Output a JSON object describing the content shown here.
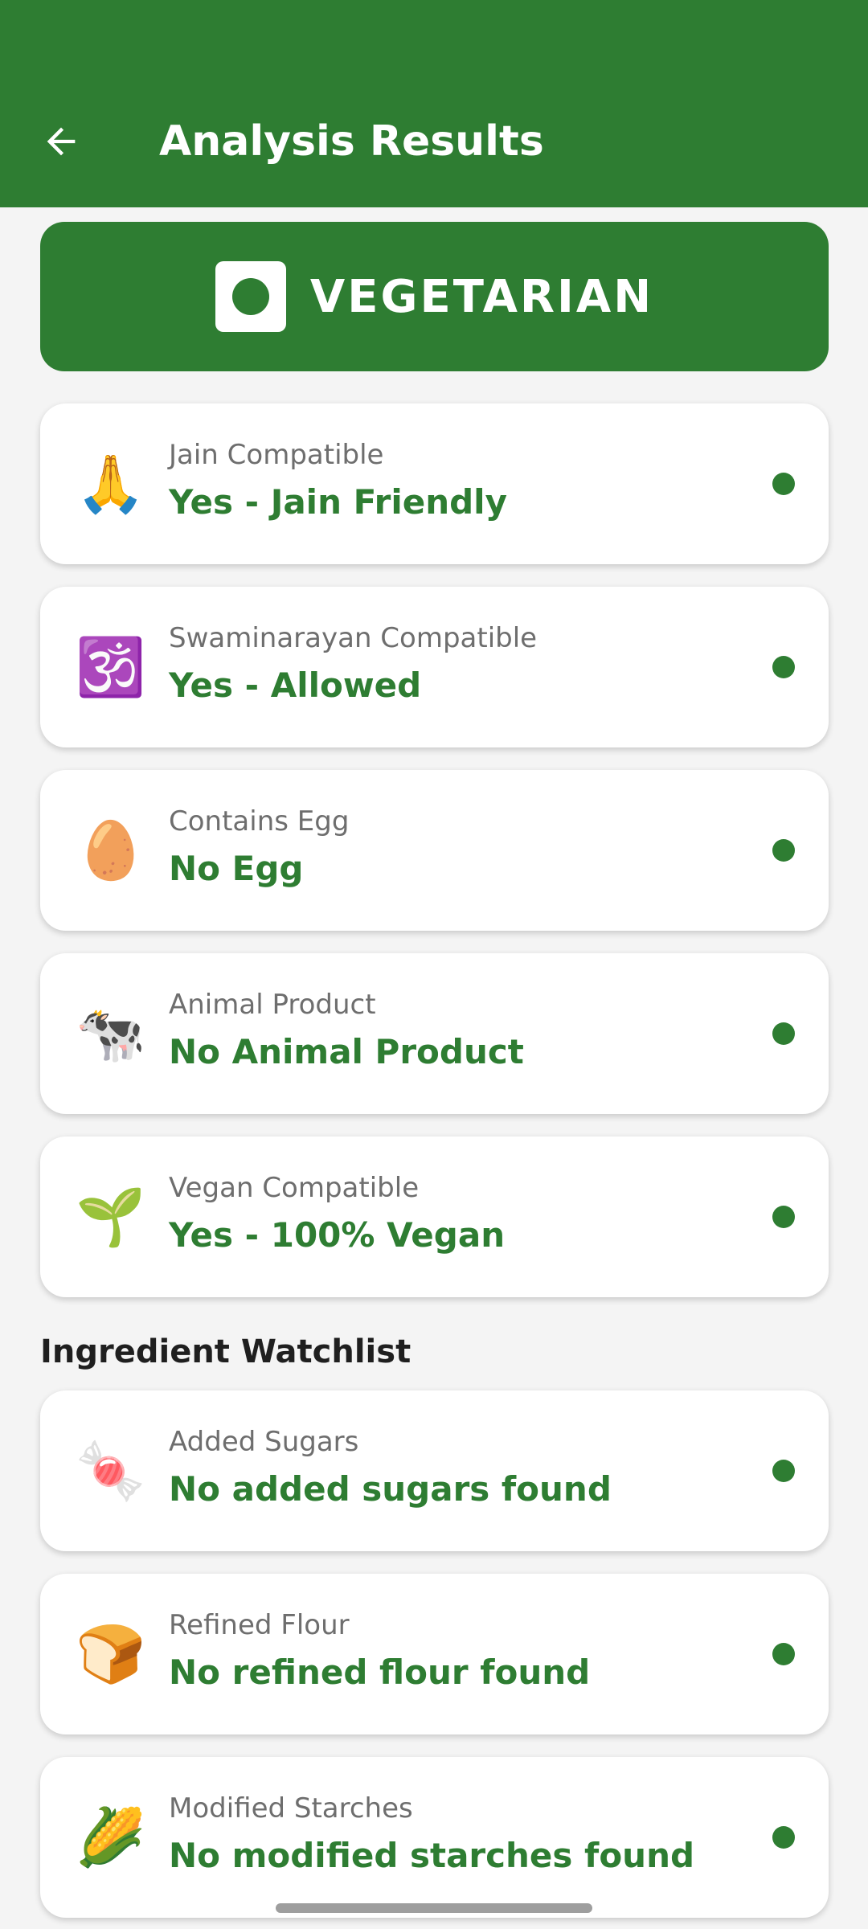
{
  "appbar": {
    "title": "Analysis Results",
    "back_icon": "arrow-left-icon",
    "color": "#2e7d32"
  },
  "banner": {
    "text": "VEGETARIAN",
    "icon": "veg-symbol-icon",
    "color": "#2e7d32"
  },
  "status_color": "#2e7d32",
  "diet_cards": [
    {
      "icon": "🙏",
      "icon_name": "folded-hands-icon",
      "label": "Jain Compatible",
      "value": "Yes - Jain Friendly"
    },
    {
      "icon": "🕉️",
      "icon_name": "om-icon",
      "label": "Swaminarayan Compatible",
      "value": "Yes - Allowed"
    },
    {
      "icon": "🥚",
      "icon_name": "egg-icon",
      "label": "Contains Egg",
      "value": "No Egg"
    },
    {
      "icon": "🐄",
      "icon_name": "cow-icon",
      "label": "Animal Product",
      "value": "No Animal Product"
    },
    {
      "icon": "🌱",
      "icon_name": "seedling-icon",
      "label": "Vegan Compatible",
      "value": "Yes - 100% Vegan"
    }
  ],
  "watchlist": {
    "title": "Ingredient Watchlist",
    "items": [
      {
        "icon": "🍬",
        "icon_name": "candy-icon",
        "label": "Added Sugars",
        "value": "No added sugars found"
      },
      {
        "icon": "🍞",
        "icon_name": "bread-icon",
        "label": "Refined Flour",
        "value": "No refined flour found"
      },
      {
        "icon": "🌽",
        "icon_name": "corn-icon",
        "label": "Modified Starches",
        "value": "No modified starches found"
      }
    ]
  }
}
